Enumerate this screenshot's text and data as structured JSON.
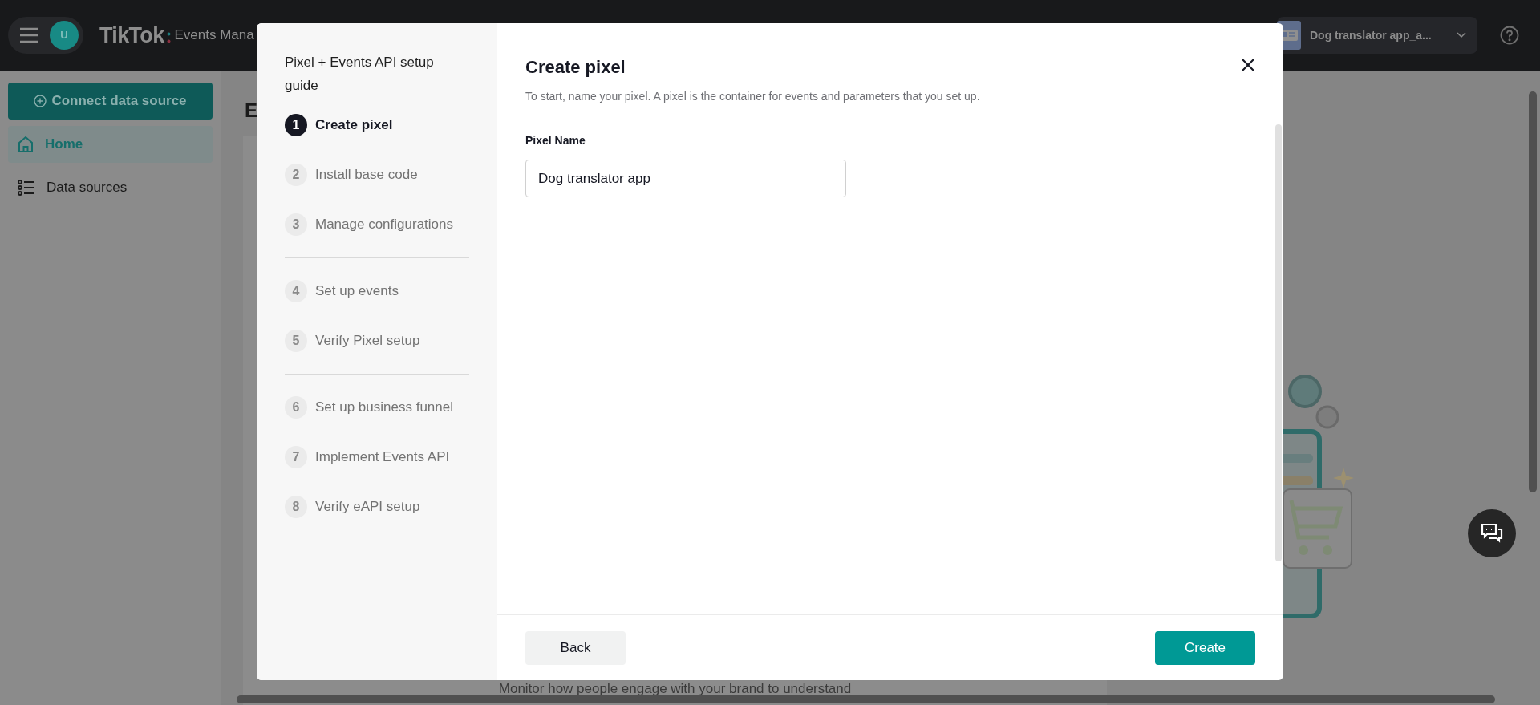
{
  "top_bar": {
    "avatar_initial": "U",
    "logo": "TikTok",
    "product": "Events Mana",
    "account": "Dog translator app_a..."
  },
  "sidebar": {
    "connect_button": "Connect data source",
    "items": [
      {
        "label": "Home",
        "selected": true
      },
      {
        "label": "Data sources",
        "selected": false
      }
    ]
  },
  "page": {
    "heading": "E",
    "footer_text": "Monitor how people engage with your brand to understand"
  },
  "dialog": {
    "guide_title": "Pixel + Events API setup guide",
    "step_groups": [
      {
        "steps": [
          {
            "number": "1",
            "label": "Create pixel",
            "selected": true
          },
          {
            "number": "2",
            "label": "Install base code",
            "selected": false
          },
          {
            "number": "3",
            "label": "Manage configurations",
            "selected": false
          }
        ]
      },
      {
        "steps": [
          {
            "number": "4",
            "label": "Set up events",
            "selected": false
          },
          {
            "number": "5",
            "label": "Verify Pixel setup",
            "selected": false
          }
        ]
      },
      {
        "steps": [
          {
            "number": "6",
            "label": "Set up business funnel",
            "selected": false
          },
          {
            "number": "7",
            "label": "Implement Events API",
            "selected": false
          },
          {
            "number": "8",
            "label": "Verify eAPI setup",
            "selected": false
          }
        ]
      }
    ],
    "title": "Create pixel",
    "description": "To start, name your pixel. A pixel is the container for events and parameters that you set up.",
    "field_label": "Pixel Name",
    "field_value": "Dog translator app",
    "back_button": "Back",
    "create_button": "Create"
  }
}
